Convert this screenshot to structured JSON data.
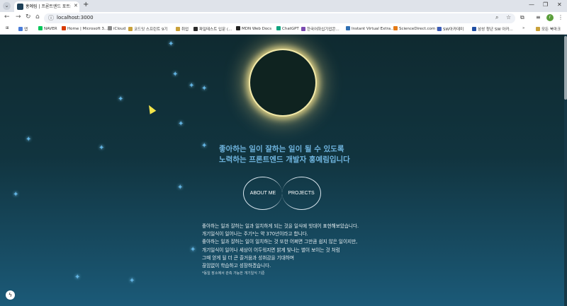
{
  "browser": {
    "tab_title": "홍예림 | 프론트엔드 포트폴리오",
    "url": "localhost:3000",
    "profile_initial": "r",
    "bookmarks": [
      {
        "label": "앱",
        "color": "#4a7dd8"
      },
      {
        "label": "NAVER",
        "color": "#03c75a"
      },
      {
        "label": "Home | Microsoft 3...",
        "color": "#d83b01"
      },
      {
        "label": "iCloud",
        "color": "#888888"
      },
      {
        "label": "코드잇 스프린트 9기",
        "color": "#c9a13a"
      },
      {
        "label": "취업",
        "color": "#c9a13a"
      },
      {
        "label": "파일테스트 입문 (...",
        "color": "#2b2b2b"
      },
      {
        "label": "MDN Web Docs",
        "color": "#222222"
      },
      {
        "label": "ChatGPT",
        "color": "#10a37f"
      },
      {
        "label": "한국어하십기업콘...",
        "color": "#7a4ab0"
      },
      {
        "label": "Instant Virtual Extra...",
        "color": "#2f6fb3"
      },
      {
        "label": "ScienceDirect.com |...",
        "color": "#e47a16"
      },
      {
        "label": "SW아카데미",
        "color": "#3b5cb8"
      },
      {
        "label": "삼성 청년 SW 아카...",
        "color": "#1f4ea3"
      }
    ],
    "all_bookmarks": "모든 북마크"
  },
  "hero": {
    "headline_line1": "좋아하는 일이 잘하는 일이 될 수 있도록",
    "headline_line2": "노력하는 프론트엔드 개발자 홍예림입니다"
  },
  "nav": {
    "about": "ABOUT ME",
    "projects": "PROJECTS"
  },
  "intro": {
    "lines": [
      "좋아하는 일과 잘하는 일과 일치하게 되는 것을 일식에 빗대어 표현해보았습니다.",
      "개기일식이 일어나는 주기*는 약 370년이라고 합니다.",
      "좋아하는 일과 잘하는 일이 일치하는 것 또한 어쩌면 그만큼 쉽지 않은 일이지만,",
      "개기일식이 일어나 세상이 어두워지면 밝게 빛나는 별이 보이는 것 처럼",
      "그때 얻게 될 더 큰 즐거움과 성취감을 기대하며",
      "끊임없이 학습하고 성장하겠습니다."
    ],
    "note": "*동일 장소에서 관측 가능한 개기일식 기준"
  }
}
